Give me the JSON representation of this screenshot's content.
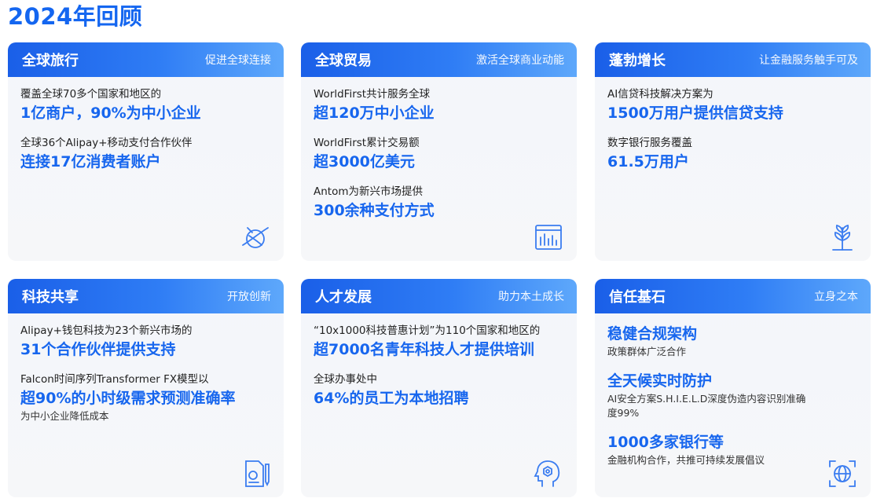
{
  "page": {
    "title": "2024年回顾"
  },
  "cards": [
    {
      "title": "全球旅行",
      "tag": "促进全球连接",
      "items": [
        {
          "label": "覆盖全球70多个国家和地区的",
          "value": "1亿商户，90%为中小企业"
        },
        {
          "label": "全球36个Alipay+移动支付合作伙伴",
          "value": "连接17亿消费者账户"
        }
      ],
      "icon": "planet-icon"
    },
    {
      "title": "全球贸易",
      "tag": "激活全球商业动能",
      "items": [
        {
          "label": "WorldFirst共计服务全球",
          "value": "超120万中小企业"
        },
        {
          "label": "WorldFirst累计交易额",
          "value": "超3000亿美元"
        },
        {
          "label": "Antom为新兴市场提供",
          "value": "300余种支付方式"
        }
      ],
      "icon": "bar-chart-icon"
    },
    {
      "title": "蓬勃增长",
      "tag": "让金融服务触手可及",
      "items": [
        {
          "label": "AI信贷科技解决方案为",
          "value": "1500万用户提供信贷支持"
        },
        {
          "label": "数字银行服务覆盖",
          "value": "61.5万用户"
        }
      ],
      "icon": "sprout-icon"
    },
    {
      "title": "科技共享",
      "tag": "开放创新",
      "items": [
        {
          "label": "Alipay+钱包科技为23个新兴市场的",
          "value": "31个合作伙伴提供支持"
        },
        {
          "label": "Falcon时间序列Transformer FX模型以",
          "value": "超90%的小时级需求预测准确率",
          "sub": "为中小企业降低成本"
        }
      ],
      "icon": "document-pen-icon"
    },
    {
      "title": "人才发展",
      "tag": "助力本土成长",
      "items": [
        {
          "label": "“10x1000科技普惠计划”为110个国家和地区的",
          "value": "超7000名青年科技人才提供培训"
        },
        {
          "label": "全球办事处中",
          "value": "64%的员工为本地招聘"
        }
      ],
      "icon": "brain-head-icon"
    },
    {
      "title": "信任基石",
      "tag": "立身之本",
      "items": [
        {
          "value": "稳健合规架构",
          "sub": "政策群体广泛合作"
        },
        {
          "value": "全天候实时防护",
          "sub": "AI安全方案S.H.I.E.L.D深度伪造内容识别准确度99%"
        },
        {
          "value": "1000多家银行等",
          "sub": "金融机构合作，共推可持续发展倡议"
        }
      ],
      "icon": "globe-scan-icon"
    }
  ]
}
